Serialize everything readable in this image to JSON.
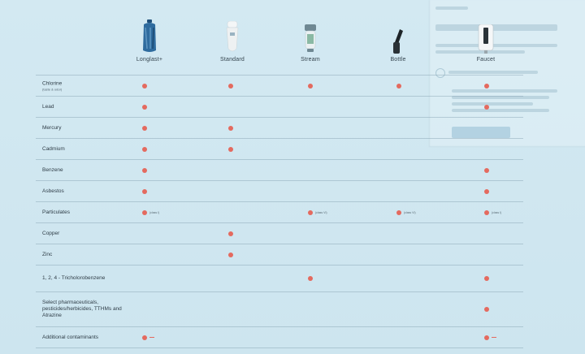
{
  "products": [
    {
      "name": "Longlast+",
      "icon": "longlast-filter-icon"
    },
    {
      "name": "Standard",
      "icon": "standard-filter-icon"
    },
    {
      "name": "Stream",
      "icon": "stream-filter-icon"
    },
    {
      "name": "Bottle",
      "icon": "bottle-filter-icon"
    },
    {
      "name": "Faucet",
      "icon": "faucet-filter-icon"
    }
  ],
  "rows": [
    {
      "label": "Chlorine",
      "sub": "(taste & odor)",
      "size": "normal",
      "marks": [
        1,
        1,
        1,
        1,
        1
      ]
    },
    {
      "label": "Lead",
      "sub": "",
      "size": "normal",
      "marks": [
        1,
        0,
        0,
        0,
        1
      ]
    },
    {
      "label": "Mercury",
      "sub": "",
      "size": "normal",
      "marks": [
        1,
        1,
        0,
        0,
        0
      ]
    },
    {
      "label": "Cadmium",
      "sub": "",
      "size": "normal",
      "marks": [
        1,
        1,
        0,
        0,
        0
      ]
    },
    {
      "label": "Benzene",
      "sub": "",
      "size": "normal",
      "marks": [
        1,
        0,
        0,
        0,
        1
      ]
    },
    {
      "label": "Asbestos",
      "sub": "",
      "size": "normal",
      "marks": [
        1,
        0,
        0,
        0,
        1
      ]
    },
    {
      "label": "Particulates",
      "sub": "",
      "size": "normal",
      "marks": [
        1,
        0,
        1,
        1,
        1
      ],
      "notes": [
        "(class I)",
        "",
        "(class VI)",
        "(class VI)",
        "(class I)"
      ]
    },
    {
      "label": "Copper",
      "sub": "",
      "size": "normal",
      "marks": [
        0,
        1,
        0,
        0,
        0
      ]
    },
    {
      "label": "Zinc",
      "sub": "",
      "size": "normal",
      "marks": [
        0,
        1,
        0,
        0,
        0
      ]
    },
    {
      "label": "1, 2, 4 - Tricholorobenzene",
      "sub": "",
      "size": "tall",
      "marks": [
        0,
        0,
        1,
        0,
        1
      ]
    },
    {
      "label": "Select pharmaceuticals, pesticides/herbicides, TTHMs and Atrazine",
      "sub": "",
      "size": "xtall",
      "marks": [
        0,
        0,
        0,
        0,
        1
      ]
    },
    {
      "label": "Additional contaminants",
      "sub": "",
      "size": "normal",
      "marks": [
        1,
        0,
        0,
        0,
        1
      ],
      "dash": [
        1,
        0,
        0,
        0,
        1
      ]
    }
  ],
  "colors": {
    "background": "#cfe6f0",
    "dot": "#e46a5f",
    "text": "#2f3d47",
    "rule": "#8aa0ad"
  }
}
